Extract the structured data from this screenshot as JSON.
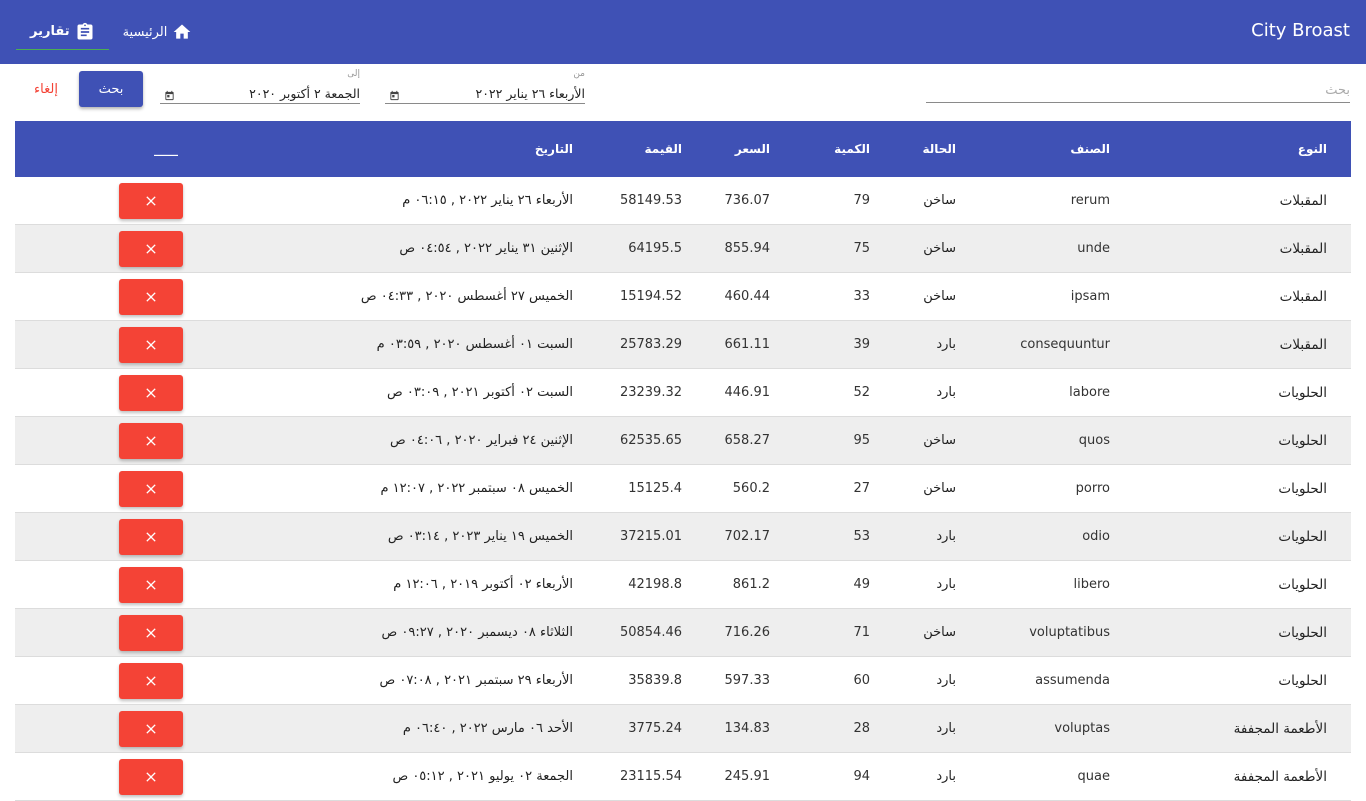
{
  "app": {
    "brand": "City Broast"
  },
  "nav": {
    "home_label": "الرئيسية",
    "reports_label": "تقارير",
    "home_icon": "home-icon",
    "reports_icon": "clipboard-icon"
  },
  "filter": {
    "search_placeholder": "بحث",
    "from_label": "من",
    "from_value": "الأربعاء ٢٦ يناير ٢٠٢٢",
    "to_label": "إلى",
    "to_value": "الجمعة ٢ أكتوبر ٢٠٢٠",
    "search_button": "بحث",
    "cancel_button": "إلغاء"
  },
  "colors": {
    "primary": "#3f51b5",
    "danger": "#f44336",
    "accent": "#4caf50",
    "row_alt": "#eeeeee"
  },
  "table": {
    "headers": {
      "type": "النوع",
      "item": "الصنف",
      "state": "الحالة",
      "qty": "الكمية",
      "price": "السعر",
      "value": "القيمة",
      "date": "التاريخ",
      "actions": "____"
    },
    "rows": [
      {
        "type": "المقبلات",
        "item": "rerum",
        "state": "ساخن",
        "qty": "79",
        "price": "736.07",
        "value": "58149.53",
        "date": "الأربعاء ٢٦ يناير ٢٠٢٢ , ٠٦:١٥ م"
      },
      {
        "type": "المقبلات",
        "item": "unde",
        "state": "ساخن",
        "qty": "75",
        "price": "855.94",
        "value": "64195.5",
        "date": "الإثنين ٣١ يناير ٢٠٢٢ , ٠٤:٥٤ ص"
      },
      {
        "type": "المقبلات",
        "item": "ipsam",
        "state": "ساخن",
        "qty": "33",
        "price": "460.44",
        "value": "15194.52",
        "date": "الخميس ٢٧ أغسطس ٢٠٢٠ , ٠٤:٣٣ ص"
      },
      {
        "type": "المقبلات",
        "item": "consequuntur",
        "state": "بارد",
        "qty": "39",
        "price": "661.11",
        "value": "25783.29",
        "date": "السبت ٠١ أغسطس ٢٠٢٠ , ٠٣:٥٩ م"
      },
      {
        "type": "الحلويات",
        "item": "labore",
        "state": "بارد",
        "qty": "52",
        "price": "446.91",
        "value": "23239.32",
        "date": "السبت ٠٢ أكتوبر ٢٠٢١ , ٠٣:٠٩ ص"
      },
      {
        "type": "الحلويات",
        "item": "quos",
        "state": "ساخن",
        "qty": "95",
        "price": "658.27",
        "value": "62535.65",
        "date": "الإثنين ٢٤ فبراير ٢٠٢٠ , ٠٤:٠٦ ص"
      },
      {
        "type": "الحلويات",
        "item": "porro",
        "state": "ساخن",
        "qty": "27",
        "price": "560.2",
        "value": "15125.4",
        "date": "الخميس ٠٨ سبتمبر ٢٠٢٢ , ١٢:٠٧ م"
      },
      {
        "type": "الحلويات",
        "item": "odio",
        "state": "بارد",
        "qty": "53",
        "price": "702.17",
        "value": "37215.01",
        "date": "الخميس ١٩ يناير ٢٠٢٣ , ٠٣:١٤ ص"
      },
      {
        "type": "الحلويات",
        "item": "libero",
        "state": "بارد",
        "qty": "49",
        "price": "861.2",
        "value": "42198.8",
        "date": "الأربعاء ٠٢ أكتوبر ٢٠١٩ , ١٢:٠٦ م"
      },
      {
        "type": "الحلويات",
        "item": "voluptatibus",
        "state": "ساخن",
        "qty": "71",
        "price": "716.26",
        "value": "50854.46",
        "date": "الثلاثاء ٠٨ ديسمبر ٢٠٢٠ , ٠٩:٢٧ ص"
      },
      {
        "type": "الحلويات",
        "item": "assumenda",
        "state": "بارد",
        "qty": "60",
        "price": "597.33",
        "value": "35839.8",
        "date": "الأربعاء ٢٩ سبتمبر ٢٠٢١ , ٠٧:٠٨ ص"
      },
      {
        "type": "الأطعمة المجففة",
        "item": "voluptas",
        "state": "بارد",
        "qty": "28",
        "price": "134.83",
        "value": "3775.24",
        "date": "الأحد ٠٦ مارس ٢٠٢٢ , ٠٦:٤٠ م"
      },
      {
        "type": "الأطعمة المجففة",
        "item": "quae",
        "state": "بارد",
        "qty": "94",
        "price": "245.91",
        "value": "23115.54",
        "date": "الجمعة ٠٢ يوليو ٢٠٢١ , ٠٥:١٢ ص"
      }
    ]
  }
}
